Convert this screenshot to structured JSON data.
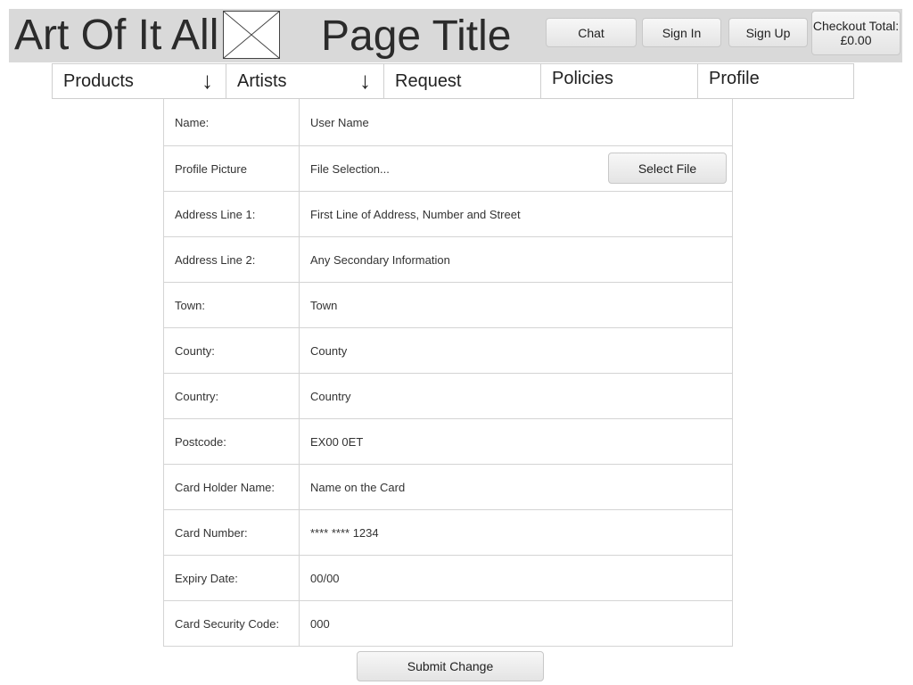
{
  "header": {
    "site_title": "Art Of It All",
    "page_title": "Page Title",
    "buttons": {
      "chat": "Chat",
      "sign_in": "Sign In",
      "sign_up": "Sign Up"
    },
    "checkout": {
      "label": "Checkout Total:",
      "amount": "£0.00"
    }
  },
  "nav": {
    "items": [
      {
        "label": "Products",
        "icon": "down-arrow-icon"
      },
      {
        "label": "Artists",
        "icon": "down-arrow-icon"
      },
      {
        "label": "Request"
      },
      {
        "label": "Policies"
      },
      {
        "label": "Profile"
      }
    ]
  },
  "form": {
    "rows": [
      {
        "label": "Name:",
        "value": "User Name"
      },
      {
        "label": "Profile Picture",
        "value": "File Selection...",
        "button": "Select File"
      },
      {
        "label": "Address Line 1:",
        "value": "First Line of Address, Number and Street"
      },
      {
        "label": "Address Line 2:",
        "value": "Any Secondary Information"
      },
      {
        "label": "Town:",
        "value": "Town"
      },
      {
        "label": "County:",
        "value": "County"
      },
      {
        "label": "Country:",
        "value": "Country"
      },
      {
        "label": "Postcode:",
        "value": "EX00 0ET"
      },
      {
        "label": "Card Holder Name:",
        "value": "Name on the Card"
      },
      {
        "label": "Card Number:",
        "value": "**** **** 1234"
      },
      {
        "label": "Expiry Date:",
        "value": "00/00"
      },
      {
        "label": "Card Security Code:",
        "value": "000"
      }
    ],
    "submit": "Submit Change"
  }
}
